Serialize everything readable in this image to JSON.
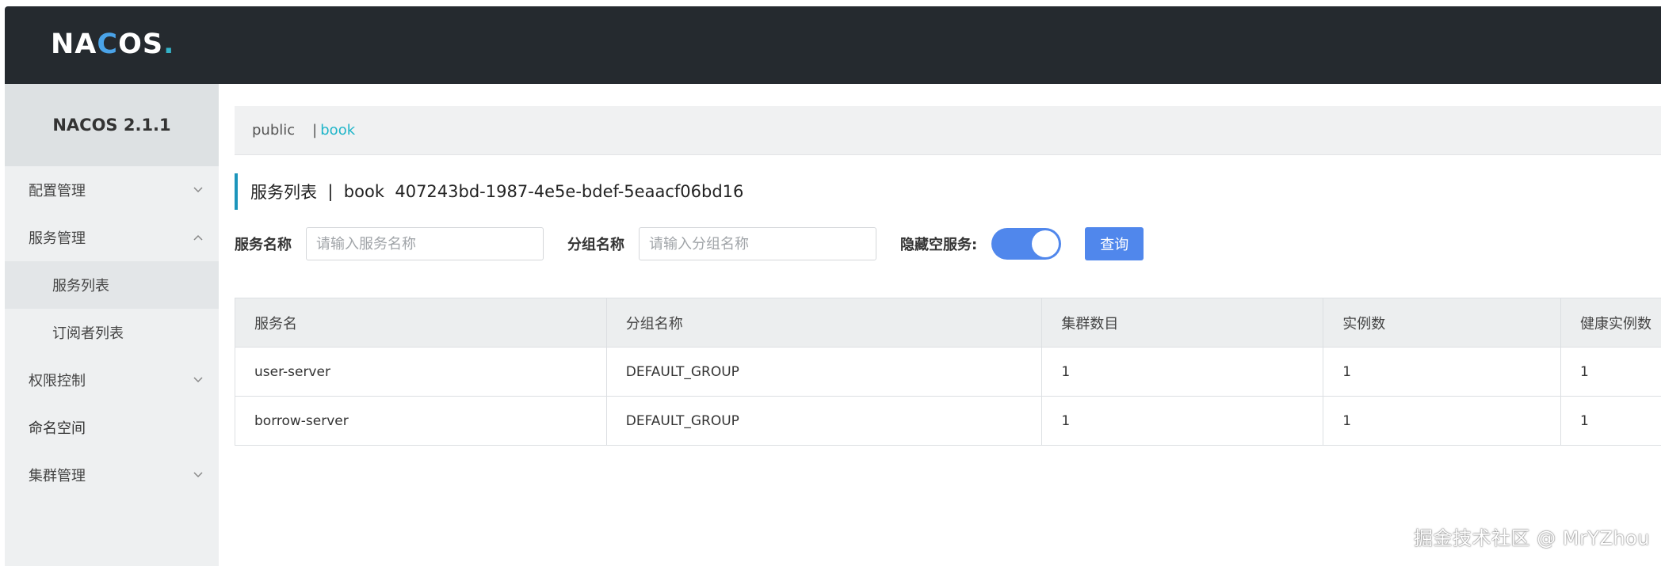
{
  "header": {
    "logo_text": "NACOS."
  },
  "sidebar": {
    "version": "NACOS 2.1.1",
    "items": [
      {
        "label": "配置管理",
        "expanded": false
      },
      {
        "label": "服务管理",
        "expanded": true
      },
      {
        "label": "服务列表",
        "sub": true,
        "active": true
      },
      {
        "label": "订阅者列表",
        "sub": true
      },
      {
        "label": "权限控制",
        "expanded": false
      },
      {
        "label": "命名空间"
      },
      {
        "label": "集群管理",
        "expanded": false
      }
    ]
  },
  "namespace_bar": {
    "items": [
      "public",
      "book"
    ],
    "separator": "|",
    "active": "book"
  },
  "page": {
    "title": "服务列表",
    "title_sep": "|",
    "namespace_name": "book",
    "namespace_id": "407243bd-1987-4e5e-bdef-5eaacf06bd16"
  },
  "filters": {
    "service_label": "服务名称",
    "service_placeholder": "请输入服务名称",
    "service_value": "",
    "group_label": "分组名称",
    "group_placeholder": "请输入分组名称",
    "group_value": "",
    "hide_empty_label": "隐藏空服务:",
    "hide_empty_on": true,
    "query_label": "查询"
  },
  "table": {
    "columns": [
      "服务名",
      "分组名称",
      "集群数目",
      "实例数",
      "健康实例数"
    ],
    "rows": [
      [
        "user-server",
        "DEFAULT_GROUP",
        "1",
        "1",
        "1"
      ],
      [
        "borrow-server",
        "DEFAULT_GROUP",
        "1",
        "1",
        "1"
      ]
    ]
  },
  "colors": {
    "topbar": "#252a2f",
    "accent": "#5087ec",
    "namespace_active": "#1fb5c9"
  },
  "watermark": "掘金技术社区 @ MrYZhou"
}
